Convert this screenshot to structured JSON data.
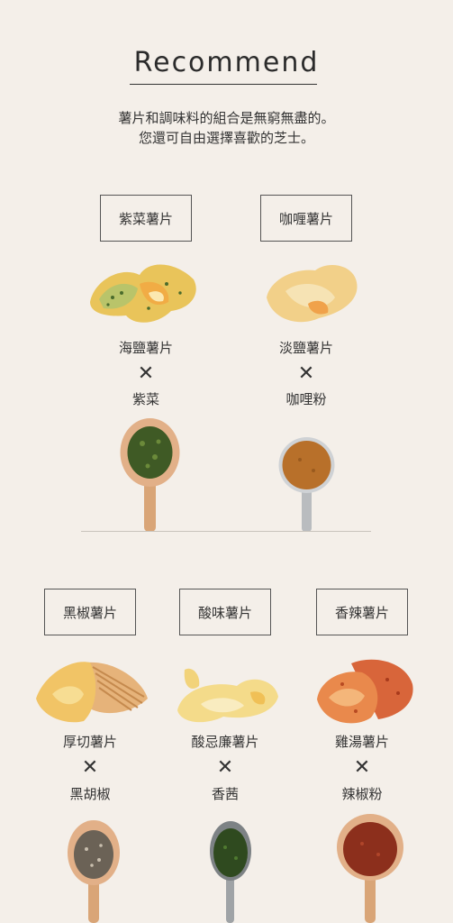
{
  "header": {
    "title": "Recommend"
  },
  "intro": {
    "line1": "薯片和調味料的組合是無窮無盡的。",
    "line2": "您還可自由選擇喜歡的芝士。"
  },
  "row1": [
    {
      "name": "紫菜薯片",
      "base": "海鹽薯片",
      "cross": "✕",
      "topping": "紫菜"
    },
    {
      "name": "咖喱薯片",
      "base": "淡鹽薯片",
      "cross": "✕",
      "topping": "咖哩粉"
    }
  ],
  "row2": [
    {
      "name": "黑椒薯片",
      "base": "厚切薯片",
      "cross": "✕",
      "topping": "黑胡椒"
    },
    {
      "name": "酸味薯片",
      "base": "酸忌廉薯片",
      "cross": "✕",
      "topping": "香茜"
    },
    {
      "name": "香辣薯片",
      "base": "雞湯薯片",
      "cross": "✕",
      "topping": "辣椒粉"
    }
  ],
  "colors": {
    "background": "#f4efe9",
    "wood": "#d9a577",
    "seaweed": "#3f5a25",
    "curry": "#b8702a",
    "pepper": "#6b6256",
    "parsley": "#2f4a1f",
    "chili": "#8c2f1c"
  }
}
